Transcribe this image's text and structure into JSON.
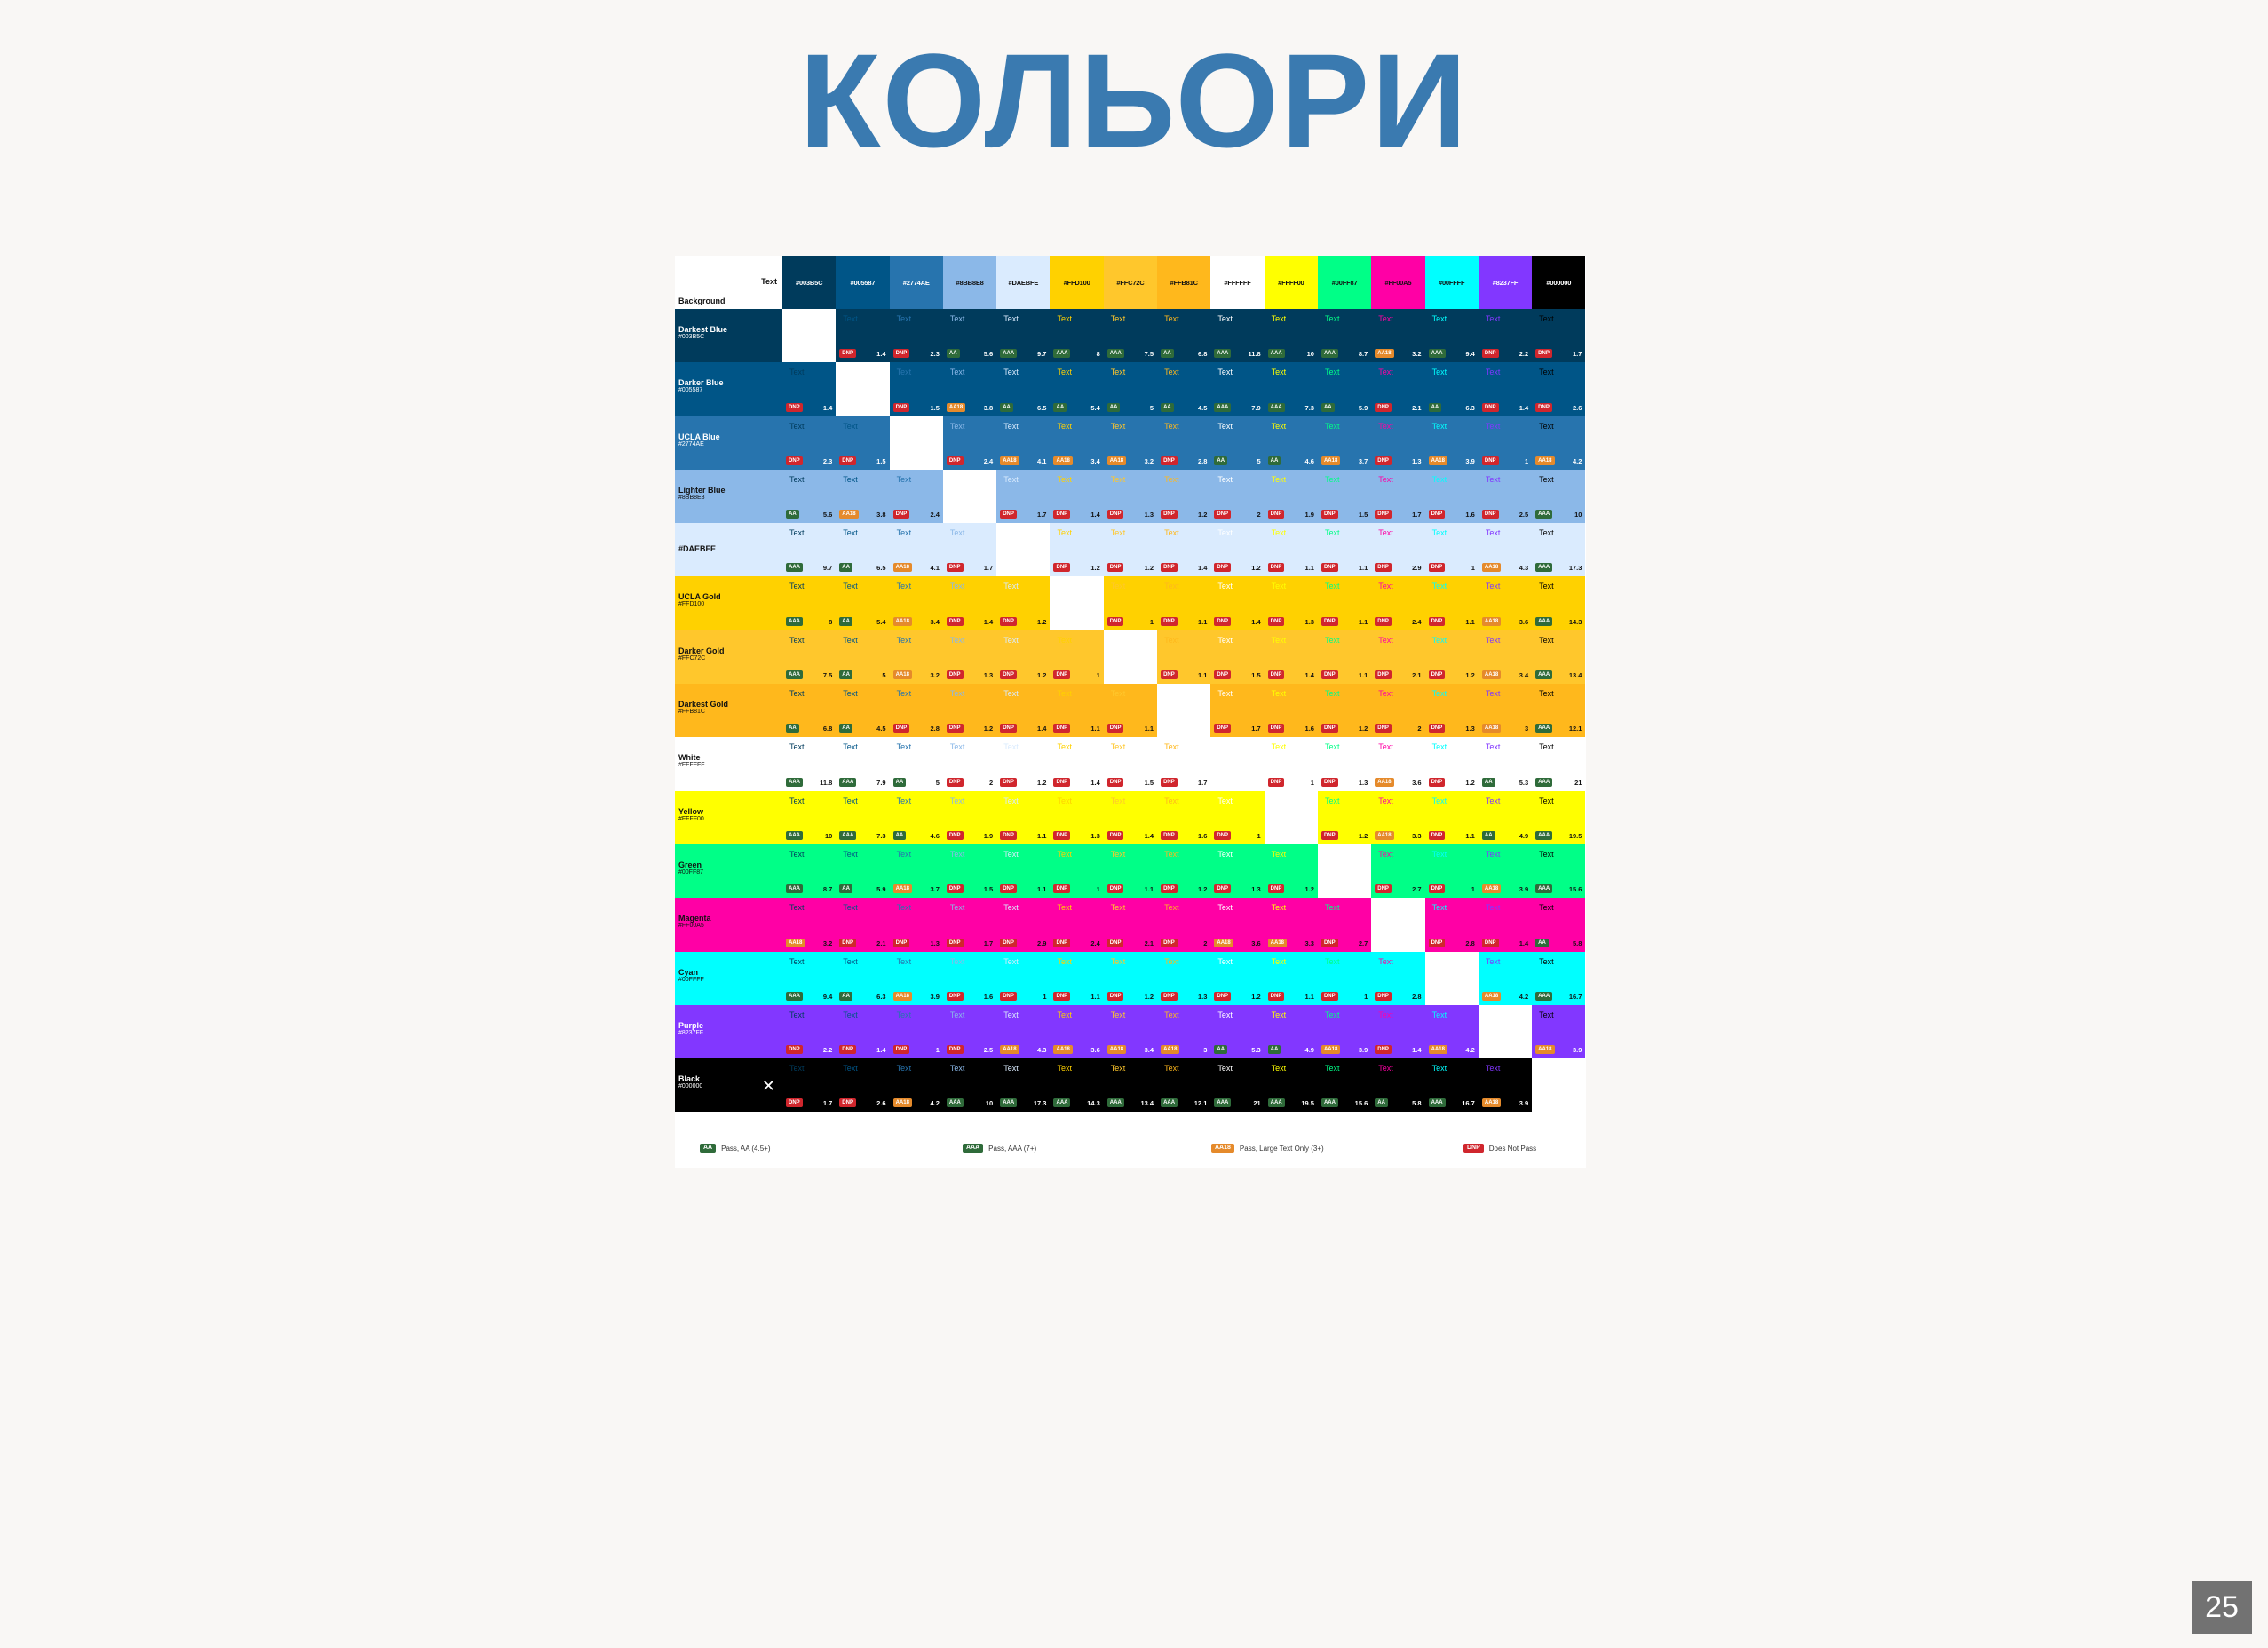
{
  "slide": {
    "title": "КОЛЬОРИ",
    "page_number": "25"
  },
  "chart_data": {
    "type": "table",
    "corner": {
      "text_label": "Text",
      "background_label": "Background"
    },
    "sample_text": "Text",
    "columns": [
      {
        "hex": "#003B5C",
        "fg": "#ffffff"
      },
      {
        "hex": "#005587",
        "fg": "#ffffff"
      },
      {
        "hex": "#2774AE",
        "fg": "#ffffff"
      },
      {
        "hex": "#8BB8E8",
        "fg": "#111111"
      },
      {
        "hex": "#DAEBFE",
        "fg": "#111111"
      },
      {
        "hex": "#FFD100",
        "fg": "#111111"
      },
      {
        "hex": "#FFC72C",
        "fg": "#111111"
      },
      {
        "hex": "#FFB81C",
        "fg": "#111111"
      },
      {
        "hex": "#FFFFFF",
        "fg": "#111111"
      },
      {
        "hex": "#FFFF00",
        "fg": "#111111"
      },
      {
        "hex": "#00FF87",
        "fg": "#111111"
      },
      {
        "hex": "#FF00A5",
        "fg": "#111111"
      },
      {
        "hex": "#00FFFF",
        "fg": "#111111"
      },
      {
        "hex": "#8237FF",
        "fg": "#ffffff"
      },
      {
        "hex": "#000000",
        "fg": "#ffffff"
      }
    ],
    "rows": [
      {
        "name": "Darkest Blue",
        "hex": "#003B5C",
        "fg": "#ffffff",
        "cells": [
          null,
          [
            "DNP",
            "1.4"
          ],
          [
            "DNP",
            "2.3"
          ],
          [
            "AA",
            "5.6"
          ],
          [
            "AAA",
            "9.7"
          ],
          [
            "AAA",
            "8"
          ],
          [
            "AAA",
            "7.5"
          ],
          [
            "AA",
            "6.8"
          ],
          [
            "AAA",
            "11.8"
          ],
          [
            "AAA",
            "10"
          ],
          [
            "AAA",
            "8.7"
          ],
          [
            "AA18",
            "3.2"
          ],
          [
            "AAA",
            "9.4"
          ],
          [
            "DNP",
            "2.2"
          ],
          [
            "DNP",
            "1.7"
          ]
        ]
      },
      {
        "name": "Darker Blue",
        "hex": "#005587",
        "fg": "#ffffff",
        "cells": [
          [
            "DNP",
            "1.4"
          ],
          null,
          [
            "DNP",
            "1.5"
          ],
          [
            "AA18",
            "3.8"
          ],
          [
            "AA",
            "6.5"
          ],
          [
            "AA",
            "5.4"
          ],
          [
            "AA",
            "5"
          ],
          [
            "AA",
            "4.5"
          ],
          [
            "AAA",
            "7.9"
          ],
          [
            "AAA",
            "7.3"
          ],
          [
            "AA",
            "5.9"
          ],
          [
            "DNP",
            "2.1"
          ],
          [
            "AA",
            "6.3"
          ],
          [
            "DNP",
            "1.4"
          ],
          [
            "DNP",
            "2.6"
          ]
        ]
      },
      {
        "name": "UCLA Blue",
        "hex": "#2774AE",
        "fg": "#ffffff",
        "cells": [
          [
            "DNP",
            "2.3"
          ],
          [
            "DNP",
            "1.5"
          ],
          null,
          [
            "DNP",
            "2.4"
          ],
          [
            "AA18",
            "4.1"
          ],
          [
            "AA18",
            "3.4"
          ],
          [
            "AA18",
            "3.2"
          ],
          [
            "DNP",
            "2.8"
          ],
          [
            "AA",
            "5"
          ],
          [
            "AA",
            "4.6"
          ],
          [
            "AA18",
            "3.7"
          ],
          [
            "DNP",
            "1.3"
          ],
          [
            "AA18",
            "3.9"
          ],
          [
            "DNP",
            "1"
          ],
          [
            "AA18",
            "4.2"
          ]
        ]
      },
      {
        "name": "Lighter Blue",
        "hex": "#8BB8E8",
        "fg": "#111111",
        "cells": [
          [
            "AA",
            "5.6"
          ],
          [
            "AA18",
            "3.8"
          ],
          [
            "DNP",
            "2.4"
          ],
          null,
          [
            "DNP",
            "1.7"
          ],
          [
            "DNP",
            "1.4"
          ],
          [
            "DNP",
            "1.3"
          ],
          [
            "DNP",
            "1.2"
          ],
          [
            "DNP",
            "2"
          ],
          [
            "DNP",
            "1.9"
          ],
          [
            "DNP",
            "1.5"
          ],
          [
            "DNP",
            "1.7"
          ],
          [
            "DNP",
            "1.6"
          ],
          [
            "DNP",
            "2.5"
          ],
          [
            "AAA",
            "10"
          ]
        ]
      },
      {
        "name": "#DAEBFE",
        "hex": "",
        "fg": "#111111",
        "cells": [
          [
            "AAA",
            "9.7"
          ],
          [
            "AA",
            "6.5"
          ],
          [
            "AA18",
            "4.1"
          ],
          [
            "DNP",
            "1.7"
          ],
          null,
          [
            "DNP",
            "1.2"
          ],
          [
            "DNP",
            "1.2"
          ],
          [
            "DNP",
            "1.4"
          ],
          [
            "DNP",
            "1.2"
          ],
          [
            "DNP",
            "1.1"
          ],
          [
            "DNP",
            "1.1"
          ],
          [
            "DNP",
            "2.9"
          ],
          [
            "DNP",
            "1"
          ],
          [
            "AA18",
            "4.3"
          ],
          [
            "AAA",
            "17.3"
          ]
        ]
      },
      {
        "name": "UCLA Gold",
        "hex": "#FFD100",
        "fg": "#111111",
        "cells": [
          [
            "AAA",
            "8"
          ],
          [
            "AA",
            "5.4"
          ],
          [
            "AA18",
            "3.4"
          ],
          [
            "DNP",
            "1.4"
          ],
          [
            "DNP",
            "1.2"
          ],
          null,
          [
            "DNP",
            "1"
          ],
          [
            "DNP",
            "1.1"
          ],
          [
            "DNP",
            "1.4"
          ],
          [
            "DNP",
            "1.3"
          ],
          [
            "DNP",
            "1.1"
          ],
          [
            "DNP",
            "2.4"
          ],
          [
            "DNP",
            "1.1"
          ],
          [
            "AA18",
            "3.6"
          ],
          [
            "AAA",
            "14.3"
          ]
        ]
      },
      {
        "name": "Darker Gold",
        "hex": "#FFC72C",
        "fg": "#111111",
        "cells": [
          [
            "AAA",
            "7.5"
          ],
          [
            "AA",
            "5"
          ],
          [
            "AA18",
            "3.2"
          ],
          [
            "DNP",
            "1.3"
          ],
          [
            "DNP",
            "1.2"
          ],
          [
            "DNP",
            "1"
          ],
          null,
          [
            "DNP",
            "1.1"
          ],
          [
            "DNP",
            "1.5"
          ],
          [
            "DNP",
            "1.4"
          ],
          [
            "DNP",
            "1.1"
          ],
          [
            "DNP",
            "2.1"
          ],
          [
            "DNP",
            "1.2"
          ],
          [
            "AA18",
            "3.4"
          ],
          [
            "AAA",
            "13.4"
          ]
        ]
      },
      {
        "name": "Darkest Gold",
        "hex": "#FFB81C",
        "fg": "#111111",
        "cells": [
          [
            "AA",
            "6.8"
          ],
          [
            "AA",
            "4.5"
          ],
          [
            "DNP",
            "2.8"
          ],
          [
            "DNP",
            "1.2"
          ],
          [
            "DNP",
            "1.4"
          ],
          [
            "DNP",
            "1.1"
          ],
          [
            "DNP",
            "1.1"
          ],
          null,
          [
            "DNP",
            "1.7"
          ],
          [
            "DNP",
            "1.6"
          ],
          [
            "DNP",
            "1.2"
          ],
          [
            "DNP",
            "2"
          ],
          [
            "DNP",
            "1.3"
          ],
          [
            "AA18",
            "3"
          ],
          [
            "AAA",
            "12.1"
          ]
        ]
      },
      {
        "name": "White",
        "hex": "#FFFFFF",
        "fg": "#111111",
        "cells": [
          [
            "AAA",
            "11.8"
          ],
          [
            "AAA",
            "7.9"
          ],
          [
            "AA",
            "5"
          ],
          [
            "DNP",
            "2"
          ],
          [
            "DNP",
            "1.2"
          ],
          [
            "DNP",
            "1.4"
          ],
          [
            "DNP",
            "1.5"
          ],
          [
            "DNP",
            "1.7"
          ],
          null,
          [
            "DNP",
            "1"
          ],
          [
            "DNP",
            "1.3"
          ],
          [
            "AA18",
            "3.6"
          ],
          [
            "DNP",
            "1.2"
          ],
          [
            "AA",
            "5.3"
          ],
          [
            "AAA",
            "21"
          ]
        ]
      },
      {
        "name": "Yellow",
        "hex": "#FFFF00",
        "fg": "#111111",
        "cells": [
          [
            "AAA",
            "10"
          ],
          [
            "AAA",
            "7.3"
          ],
          [
            "AA",
            "4.6"
          ],
          [
            "DNP",
            "1.9"
          ],
          [
            "DNP",
            "1.1"
          ],
          [
            "DNP",
            "1.3"
          ],
          [
            "DNP",
            "1.4"
          ],
          [
            "DNP",
            "1.6"
          ],
          [
            "DNP",
            "1"
          ],
          null,
          [
            "DNP",
            "1.2"
          ],
          [
            "AA18",
            "3.3"
          ],
          [
            "DNP",
            "1.1"
          ],
          [
            "AA",
            "4.9"
          ],
          [
            "AAA",
            "19.5"
          ]
        ]
      },
      {
        "name": "Green",
        "hex": "#00FF87",
        "fg": "#111111",
        "cells": [
          [
            "AAA",
            "8.7"
          ],
          [
            "AA",
            "5.9"
          ],
          [
            "AA18",
            "3.7"
          ],
          [
            "DNP",
            "1.5"
          ],
          [
            "DNP",
            "1.1"
          ],
          [
            "DNP",
            "1"
          ],
          [
            "DNP",
            "1.1"
          ],
          [
            "DNP",
            "1.2"
          ],
          [
            "DNP",
            "1.3"
          ],
          [
            "DNP",
            "1.2"
          ],
          null,
          [
            "DNP",
            "2.7"
          ],
          [
            "DNP",
            "1"
          ],
          [
            "AA18",
            "3.9"
          ],
          [
            "AAA",
            "15.6"
          ]
        ]
      },
      {
        "name": "Magenta",
        "hex": "#FF00A5",
        "fg": "#111111",
        "cells": [
          [
            "AA18",
            "3.2"
          ],
          [
            "DNP",
            "2.1"
          ],
          [
            "DNP",
            "1.3"
          ],
          [
            "DNP",
            "1.7"
          ],
          [
            "DNP",
            "2.9"
          ],
          [
            "DNP",
            "2.4"
          ],
          [
            "DNP",
            "2.1"
          ],
          [
            "DNP",
            "2"
          ],
          [
            "AA18",
            "3.6"
          ],
          [
            "AA18",
            "3.3"
          ],
          [
            "DNP",
            "2.7"
          ],
          null,
          [
            "DNP",
            "2.8"
          ],
          [
            "DNP",
            "1.4"
          ],
          [
            "AA",
            "5.8"
          ]
        ]
      },
      {
        "name": "Cyan",
        "hex": "#00FFFF",
        "fg": "#111111",
        "cells": [
          [
            "AAA",
            "9.4"
          ],
          [
            "AA",
            "6.3"
          ],
          [
            "AA18",
            "3.9"
          ],
          [
            "DNP",
            "1.6"
          ],
          [
            "DNP",
            "1"
          ],
          [
            "DNP",
            "1.1"
          ],
          [
            "DNP",
            "1.2"
          ],
          [
            "DNP",
            "1.3"
          ],
          [
            "DNP",
            "1.2"
          ],
          [
            "DNP",
            "1.1"
          ],
          [
            "DNP",
            "1"
          ],
          [
            "DNP",
            "2.8"
          ],
          null,
          [
            "AA18",
            "4.2"
          ],
          [
            "AAA",
            "16.7"
          ]
        ]
      },
      {
        "name": "Purple",
        "hex": "#8237FF",
        "fg": "#ffffff",
        "cells": [
          [
            "DNP",
            "2.2"
          ],
          [
            "DNP",
            "1.4"
          ],
          [
            "DNP",
            "1"
          ],
          [
            "DNP",
            "2.5"
          ],
          [
            "AA18",
            "4.3"
          ],
          [
            "AA18",
            "3.6"
          ],
          [
            "AA18",
            "3.4"
          ],
          [
            "AA18",
            "3"
          ],
          [
            "AA",
            "5.3"
          ],
          [
            "AA",
            "4.9"
          ],
          [
            "AA18",
            "3.9"
          ],
          [
            "DNP",
            "1.4"
          ],
          [
            "AA18",
            "4.2"
          ],
          null,
          [
            "AA18",
            "3.9"
          ]
        ]
      },
      {
        "name": "Black",
        "hex": "#000000",
        "fg": "#ffffff",
        "cells": [
          [
            "DNP",
            "1.7"
          ],
          [
            "DNP",
            "2.6"
          ],
          [
            "AA18",
            "4.2"
          ],
          [
            "AAA",
            "10"
          ],
          [
            "AAA",
            "17.3"
          ],
          [
            "AAA",
            "14.3"
          ],
          [
            "AAA",
            "13.4"
          ],
          [
            "AAA",
            "12.1"
          ],
          [
            "AAA",
            "21"
          ],
          [
            "AAA",
            "19.5"
          ],
          [
            "AAA",
            "15.6"
          ],
          [
            "AA",
            "5.8"
          ],
          [
            "AAA",
            "16.7"
          ],
          [
            "AA18",
            "3.9"
          ],
          null
        ]
      }
    ],
    "legend": [
      {
        "badge": "AA",
        "text": "Pass, AA (4.5+)",
        "color": "#2f6b3a"
      },
      {
        "badge": "AAA",
        "text": "Pass, AAA (7+)",
        "color": "#2f6b3a"
      },
      {
        "badge": "AA18",
        "text": "Pass, Large Text Only (3+)",
        "color": "#e58a2b"
      },
      {
        "badge": "DNP",
        "text": "Does Not Pass",
        "color": "#d0262d"
      }
    ]
  }
}
